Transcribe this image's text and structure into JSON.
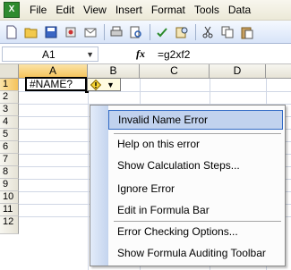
{
  "menubar": {
    "items": [
      {
        "label": "File"
      },
      {
        "label": "Edit"
      },
      {
        "label": "View"
      },
      {
        "label": "Insert"
      },
      {
        "label": "Format"
      },
      {
        "label": "Tools"
      },
      {
        "label": "Data"
      }
    ]
  },
  "formula_bar": {
    "cell_reference": "A1",
    "fx_label": "fx",
    "formula": "=g2xf2"
  },
  "grid": {
    "columns": [
      "A",
      "B",
      "C",
      "D"
    ],
    "rows": [
      "1",
      "2",
      "3",
      "4",
      "5",
      "6",
      "7",
      "8",
      "9",
      "10",
      "11",
      "12"
    ],
    "active_cell_value": "#NAME?"
  },
  "error_menu": {
    "title": "Invalid Name Error",
    "items": [
      {
        "label": "Help on this error"
      },
      {
        "label": "Show Calculation Steps..."
      },
      {
        "label": "Ignore Error"
      },
      {
        "label": "Edit in Formula Bar"
      },
      {
        "label": "Error Checking Options..."
      },
      {
        "label": "Show Formula Auditing Toolbar"
      }
    ]
  },
  "colors": {
    "accent": "#316ac5",
    "highlight": "#c1d2ee",
    "selected_header": "#f5c35a"
  }
}
